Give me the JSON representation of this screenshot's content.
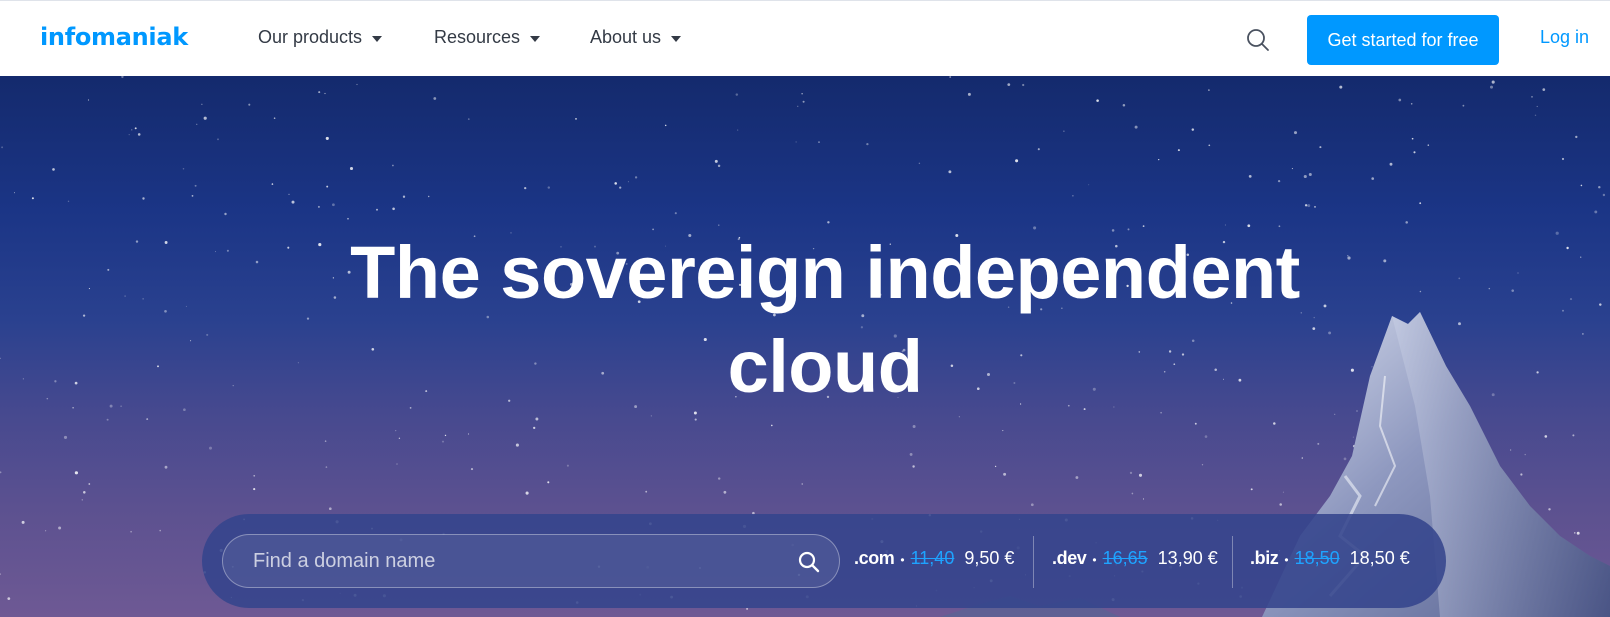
{
  "header": {
    "logo": "infomaniak",
    "nav": [
      {
        "label": "Our products"
      },
      {
        "label": "Resources"
      },
      {
        "label": "About us"
      }
    ],
    "cta_label": "Get started for free",
    "login_label": "Log in"
  },
  "hero": {
    "headline_line1": "The sovereign independent",
    "headline_line2": "cloud",
    "search": {
      "placeholder": "Find a domain name",
      "value": ""
    },
    "tlds": [
      {
        "name": ".com",
        "separator": "•",
        "old_price": "11,40",
        "new_price": "9,50 €"
      },
      {
        "name": ".dev",
        "separator": "•",
        "old_price": "16,65",
        "new_price": "13,90 €"
      },
      {
        "name": ".biz",
        "separator": "•",
        "old_price": "18,50",
        "new_price": "18,50 €"
      }
    ]
  },
  "colors": {
    "brand": "#0098ff",
    "nav_text": "#333a45",
    "strike_price": "#1ea3ff",
    "hero_top": "#142a6d",
    "hero_bottom": "#6e5994"
  },
  "icons": {
    "header_search": "search-icon",
    "input_search": "search-icon",
    "dropdown": "caret-down-icon"
  }
}
